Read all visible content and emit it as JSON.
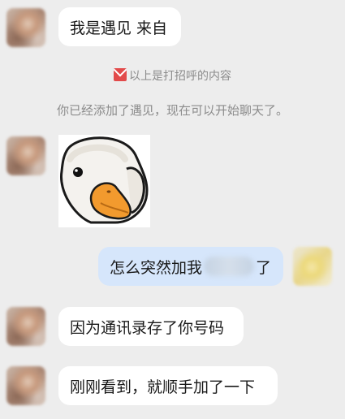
{
  "messages": {
    "m1": "我是遇见 来自",
    "m2_prefix": "怎么突然加我",
    "m2_suffix": "了",
    "m3": "因为通讯录存了你号码",
    "m4": "刚刚看到，就顺手加了一下"
  },
  "system": {
    "greeting_note": "以上是打招呼的内容",
    "added_note": "你已经添加了遇见，现在可以开始聊天了。"
  },
  "icons": {
    "greeting_icon": "envelope-icon",
    "sticker": "duck-sticker"
  },
  "colors": {
    "background": "#ededed",
    "bubble_peer": "#ffffff",
    "bubble_self": "#d6e6fb",
    "mail_icon": "#e24a4a"
  }
}
